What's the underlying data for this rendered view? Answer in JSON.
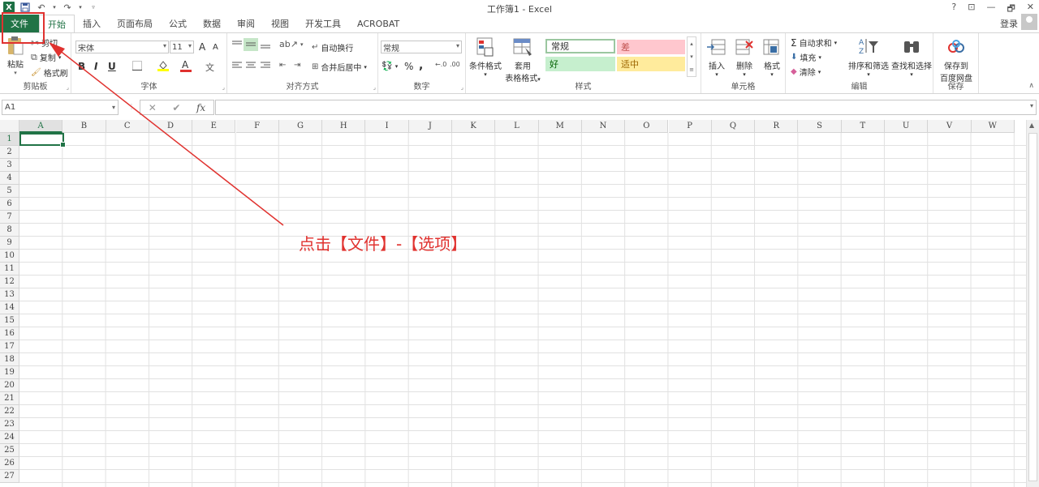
{
  "window": {
    "title": "工作簿1 - Excel",
    "help": "?",
    "ribbon_display": "⊡",
    "minimize": "—",
    "restore": "🗗",
    "close": "✕"
  },
  "qat": {
    "logo": "X"
  },
  "tabs": [
    "文件",
    "开始",
    "插入",
    "页面布局",
    "公式",
    "数据",
    "审阅",
    "视图",
    "开发工具",
    "ACROBAT"
  ],
  "account": {
    "login": "登录"
  },
  "ribbon": {
    "clipboard": {
      "paste": "粘贴",
      "cut": "剪切",
      "copy": "复制",
      "format_painter": "格式刷",
      "label": "剪贴板"
    },
    "font": {
      "name": "宋体",
      "size": "11",
      "grow": "A",
      "shrink": "A",
      "bold": "B",
      "italic": "I",
      "underline": "U",
      "label": "字体"
    },
    "alignment": {
      "wrap": "自动换行",
      "merge": "合并后居中",
      "label": "对齐方式"
    },
    "number": {
      "format": "常规",
      "percent": "%",
      "comma": ",",
      "label": "数字"
    },
    "styles": {
      "conditional": "条件格式",
      "table_format_1": "套用",
      "table_format_2": "表格格式",
      "normal": "常规",
      "bad": "差",
      "good": "好",
      "neutral": "适中",
      "label": "样式"
    },
    "cells": {
      "insert": "插入",
      "delete": "删除",
      "format": "格式",
      "label": "单元格"
    },
    "editing": {
      "autosum": "自动求和",
      "fill": "填充",
      "clear": "清除",
      "sort": "排序和筛选",
      "find": "查找和选择",
      "label": "编辑"
    },
    "save": {
      "line1": "保存到",
      "line2": "百度网盘",
      "label": "保存"
    }
  },
  "formula_bar": {
    "name_box": "A1",
    "cancel": "✕",
    "enter": "✔",
    "fx": "fx"
  },
  "columns": [
    "A",
    "B",
    "C",
    "D",
    "E",
    "F",
    "G",
    "H",
    "I",
    "J",
    "K",
    "L",
    "M",
    "N",
    "O",
    "P",
    "Q",
    "R",
    "S",
    "T",
    "U",
    "V",
    "W"
  ],
  "rows": [
    "1",
    "2",
    "3",
    "4",
    "5",
    "6",
    "7",
    "8",
    "9",
    "10",
    "11",
    "12",
    "13",
    "14",
    "15",
    "16",
    "17",
    "18",
    "19",
    "20",
    "21",
    "22",
    "23",
    "24",
    "25",
    "26",
    "27"
  ],
  "annotation": {
    "text": "点击【文件】-【选项】",
    "color": "#e0322f"
  },
  "colors": {
    "excel_green": "#217346",
    "accent_red": "#e0322f"
  }
}
